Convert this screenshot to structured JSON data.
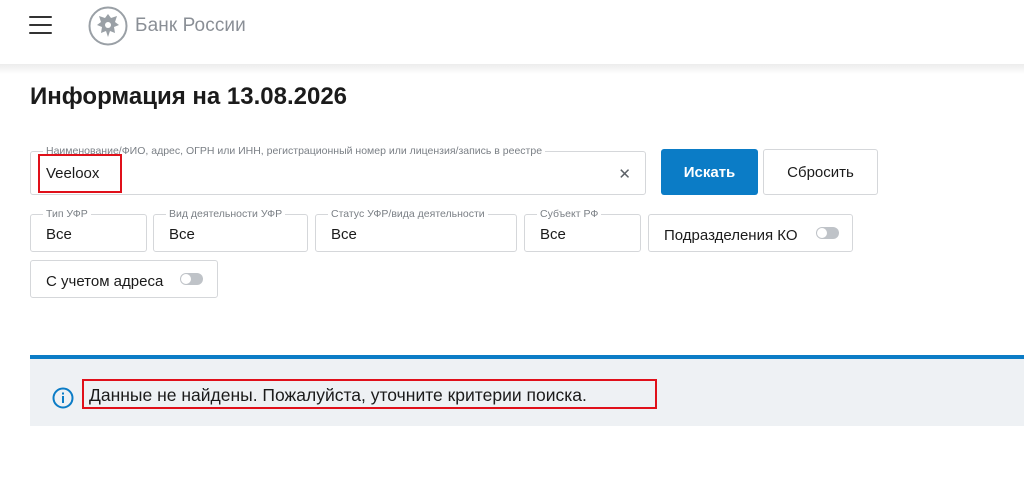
{
  "header": {
    "menu_icon": "hamburger-menu-icon",
    "logo_icon": "bank-of-russia-eagle-icon",
    "brand": "Банк России"
  },
  "page": {
    "title": "Информация на 13.08.2026"
  },
  "search": {
    "label": "Наименование/ФИО, адрес, ОГРН или ИНН, регистрационный номер или лицензия/запись в реестре",
    "value": "Veeloox",
    "clear_icon": "close-icon",
    "search_button": "Искать",
    "reset_button": "Сбросить"
  },
  "filters": {
    "type": {
      "label": "Тип УФР",
      "value": "Все"
    },
    "activity": {
      "label": "Вид деятельности УФР",
      "value": "Все"
    },
    "status": {
      "label": "Статус УФР/вида деятельности",
      "value": "Все"
    },
    "region": {
      "label": "Субъект РФ",
      "value": "Все"
    },
    "branches_toggle": {
      "label": "Подразделения КО",
      "enabled": false
    },
    "address_toggle": {
      "label": "С учетом адреса",
      "enabled": false
    }
  },
  "alert": {
    "icon": "info-icon",
    "message": "Данные не найдены. Пожалуйста, уточните критерии поиска."
  },
  "colors": {
    "accent": "#0b7cc6",
    "highlight": "#e0101a",
    "alert_background": "#eef1f4"
  }
}
